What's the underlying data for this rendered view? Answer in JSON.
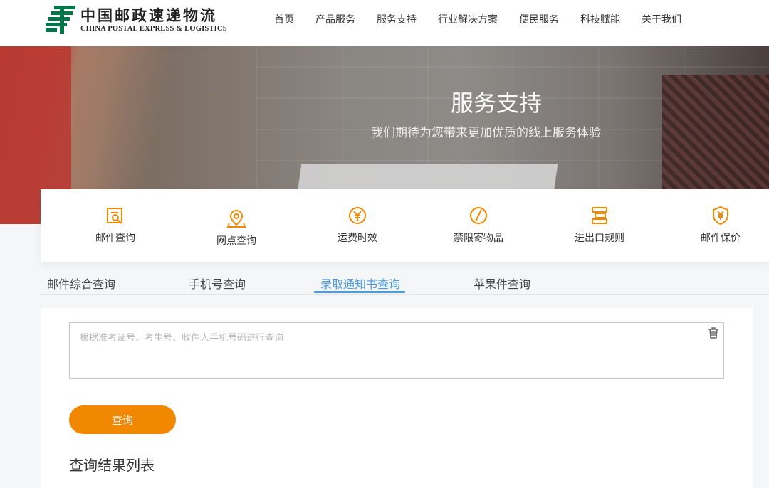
{
  "header": {
    "logo_cn": "中国邮政速递物流",
    "logo_en": "CHINA POSTAL EXPRESS & LOGISTICS",
    "nav": [
      "首页",
      "产品服务",
      "服务支持",
      "行业解决方案",
      "便民服务",
      "科技赋能",
      "关于我们"
    ]
  },
  "banner": {
    "title": "服务支持",
    "subtitle": "我们期待为您带来更加优质的线上服务体验"
  },
  "services": [
    {
      "label": "邮件查询",
      "icon": "mail-search-icon"
    },
    {
      "label": "网点查询",
      "icon": "location-pin-icon"
    },
    {
      "label": "运费时效",
      "icon": "yuan-clock-icon"
    },
    {
      "label": "禁限寄物品",
      "icon": "prohibited-icon"
    },
    {
      "label": "进出口规则",
      "icon": "rules-icon"
    },
    {
      "label": "邮件保价",
      "icon": "shield-yuan-icon"
    }
  ],
  "tabs": {
    "items": [
      "邮件综合查询",
      "手机号查询",
      "录取通知书查询",
      "苹果件查询"
    ],
    "active_index": 2
  },
  "query": {
    "placeholder": "根据准考证号、考生号、收件人手机号码进行查询",
    "value": "",
    "button_label": "查询",
    "results_title": "查询结果列表"
  },
  "colors": {
    "accent_orange": "#f18800",
    "tab_active": "#4a9ae0",
    "brand_green": "#00754a"
  }
}
